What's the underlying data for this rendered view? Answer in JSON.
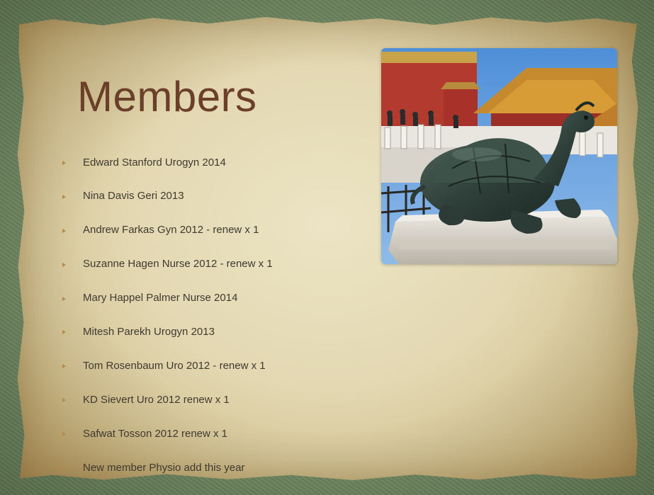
{
  "slide": {
    "title": "Members",
    "members": [
      "Edward Stanford Urogyn 2014",
      "Nina Davis Geri 2013",
      "Andrew Farkas Gyn 2012 - renew x 1",
      "Suzanne Hagen Nurse 2012 - renew x 1",
      "Mary Happel Palmer Nurse 2014",
      "Mitesh Parekh Urogyn 2013",
      "Tom Rosenbaum Uro 2012 - renew x 1",
      "KD Sievert Uro 2012 renew x 1",
      "Safwat Tosson 2012 renew x 1",
      "New member Physio add this year"
    ]
  },
  "colors": {
    "title": "#6b3f2a",
    "text": "#3f3a30",
    "bullet": "#b58a4b",
    "background": "#7c9169",
    "parchment": "#e6dcb8"
  },
  "icons": {
    "bullet": "triangle-bullet-icon"
  }
}
